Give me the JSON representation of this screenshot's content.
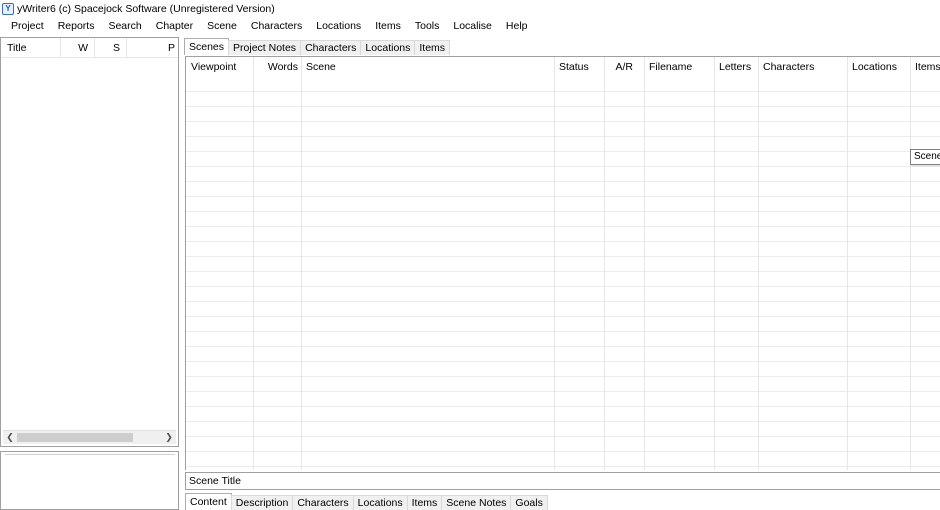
{
  "window": {
    "title": "yWriter6 (c) Spacejock Software (Unregistered Version)",
    "icon": "ywriter-app-icon"
  },
  "menu": [
    "Project",
    "Reports",
    "Search",
    "Chapter",
    "Scene",
    "Characters",
    "Locations",
    "Items",
    "Tools",
    "Localise",
    "Help"
  ],
  "chapter_list": {
    "columns": [
      "Title",
      "W",
      "S",
      "P"
    ]
  },
  "top_tabs": {
    "items": [
      "Scenes",
      "Project Notes",
      "Characters",
      "Locations",
      "Items"
    ],
    "active": "Scenes"
  },
  "scene_grid": {
    "columns": [
      "Viewpoint",
      "Words",
      "Scene",
      "Status",
      "A/R",
      "Filename",
      "Letters",
      "Characters",
      "Locations",
      "Items"
    ],
    "rows": []
  },
  "tooltip": "Scene",
  "scene_title_label": "Scene Title",
  "bottom_tabs": {
    "items": [
      "Content",
      "Description",
      "Characters",
      "Locations",
      "Items",
      "Scene Notes",
      "Goals"
    ],
    "active": "Content"
  }
}
